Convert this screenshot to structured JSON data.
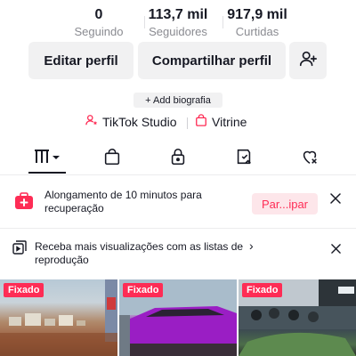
{
  "stats": [
    {
      "value": "0",
      "label": "Seguindo"
    },
    {
      "value": "113,7 mil",
      "label": "Seguidores"
    },
    {
      "value": "917,9 mil",
      "label": "Curtidas"
    }
  ],
  "actions": {
    "edit_label": "Editar perfil",
    "share_label": "Compartilhar perfil",
    "add_friend_icon": "add-user-icon"
  },
  "bio": {
    "label": "+ Add biografia"
  },
  "links": {
    "studio": "TikTok Studio",
    "vitrine": "Vitrine"
  },
  "tabs": [
    {
      "icon": "grid-icon",
      "selected": true
    },
    {
      "icon": "shopping-bag-icon"
    },
    {
      "icon": "lock-icon"
    },
    {
      "icon": "repost-icon"
    },
    {
      "icon": "liked-heart-icon"
    }
  ],
  "banner_stretch": {
    "text": "Alongamento de 10 minutos para recuperação",
    "cta": "Par...ipar"
  },
  "banner_playlist": {
    "text": "Receba mais visualizações com as listas de reprodução",
    "chevron": "›"
  },
  "videos": [
    {
      "badge": "Fixado"
    },
    {
      "badge": "Fixado"
    },
    {
      "badge": "Fixado"
    }
  ],
  "colors": {
    "accent": "#fe2c55",
    "button_bg": "#f1f1f2",
    "text": "#161823",
    "muted": "#8a8b91"
  }
}
